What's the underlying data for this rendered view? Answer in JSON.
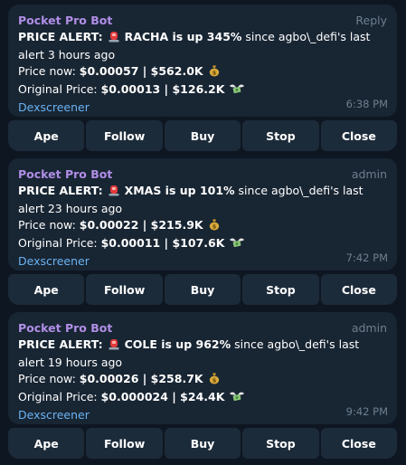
{
  "messages": [
    {
      "sender": "Pocket Pro Bot",
      "tag": "Reply",
      "alert_label": "PRICE ALERT:",
      "alert_bold": "RACHA is up 345%",
      "alert_rest": " since agbo\\_defi's last alert 3 hours ago",
      "price_now_label": "Price now: ",
      "price_now_value": "$0.00057 | $562.0K",
      "original_label": "Original Price: ",
      "original_value": "$0.00013 | $126.2K",
      "link": "Dexscreener",
      "time": "6:38 PM",
      "buttons": [
        "Ape",
        "Follow",
        "Buy",
        "Stop",
        "Close"
      ]
    },
    {
      "sender": "Pocket Pro Bot",
      "tag": "admin",
      "alert_label": "PRICE ALERT:",
      "alert_bold": "XMAS is up 101%",
      "alert_rest": " since agbo\\_defi's last alert 23 hours ago",
      "price_now_label": "Price now: ",
      "price_now_value": "$0.00022 | $215.9K",
      "original_label": "Original Price: ",
      "original_value": "$0.00011 | $107.6K",
      "link": "Dexscreener",
      "time": "7:42 PM",
      "buttons": [
        "Ape",
        "Follow",
        "Buy",
        "Stop",
        "Close"
      ]
    },
    {
      "sender": "Pocket Pro Bot",
      "tag": "admin",
      "alert_label": "PRICE ALERT:",
      "alert_bold": "COLE is up 962%",
      "alert_rest": " since agbo\\_defi's last alert 19 hours ago",
      "price_now_label": "Price now: ",
      "price_now_value": "$0.00026 | $258.7K",
      "original_label": "Original Price: ",
      "original_value": "$0.000024 | $24.4K",
      "link": "Dexscreener",
      "time": "9:42 PM",
      "buttons": [
        "Ape",
        "Follow",
        "Buy",
        "Stop",
        "Close"
      ]
    }
  ],
  "icons": {
    "siren": "police-siren-icon",
    "money_bag": "money-bag-icon",
    "money_wings": "money-with-wings-icon"
  },
  "colors": {
    "background": "#0e1621",
    "bubble": "#182533",
    "button": "#1c2b3a",
    "sender": "#b08ee6",
    "link": "#6ab3f3",
    "muted": "#6d7f8f"
  }
}
